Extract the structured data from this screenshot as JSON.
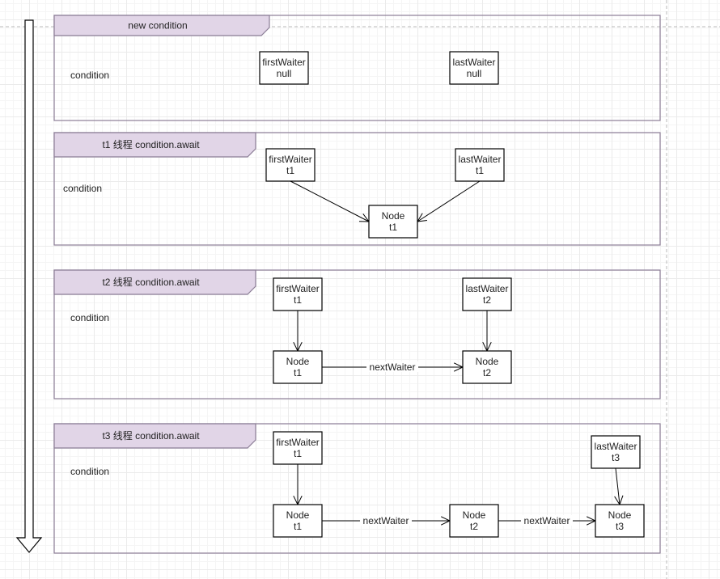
{
  "colors": {
    "frame_border": "#8b7d96",
    "tab_fill": "#e1d5e7",
    "box_border": "#000000"
  },
  "sections": [
    {
      "title": "new condition",
      "side_label": "condition",
      "boxes": [
        {
          "id": "s1-first",
          "line1": "firstWaiter",
          "line2": "null"
        },
        {
          "id": "s1-last",
          "line1": "lastWaiter",
          "line2": "null"
        }
      ],
      "edges": []
    },
    {
      "title": "t1 线程 condition.await",
      "side_label": "condition",
      "boxes": [
        {
          "id": "s2-first",
          "line1": "firstWaiter",
          "line2": "t1"
        },
        {
          "id": "s2-last",
          "line1": "lastWaiter",
          "line2": "t1"
        },
        {
          "id": "s2-node1",
          "line1": "Node",
          "line2": "t1"
        }
      ],
      "edges": [
        {
          "from": "s2-first",
          "to": "s2-node1",
          "label": ""
        },
        {
          "from": "s2-last",
          "to": "s2-node1",
          "label": ""
        }
      ]
    },
    {
      "title": "t2 线程 condition.await",
      "side_label": "condition",
      "boxes": [
        {
          "id": "s3-first",
          "line1": "firstWaiter",
          "line2": "t1"
        },
        {
          "id": "s3-last",
          "line1": "lastWaiter",
          "line2": "t2"
        },
        {
          "id": "s3-node1",
          "line1": "Node",
          "line2": "t1"
        },
        {
          "id": "s3-node2",
          "line1": "Node",
          "line2": "t2"
        }
      ],
      "edges": [
        {
          "from": "s3-first",
          "to": "s3-node1",
          "label": ""
        },
        {
          "from": "s3-last",
          "to": "s3-node2",
          "label": ""
        },
        {
          "from": "s3-node1",
          "to": "s3-node2",
          "label": "nextWaiter"
        }
      ]
    },
    {
      "title": "t3 线程 condition.await",
      "side_label": "condition",
      "boxes": [
        {
          "id": "s4-first",
          "line1": "firstWaiter",
          "line2": "t1"
        },
        {
          "id": "s4-last",
          "line1": "lastWaiter",
          "line2": "t3"
        },
        {
          "id": "s4-node1",
          "line1": "Node",
          "line2": "t1"
        },
        {
          "id": "s4-node2",
          "line1": "Node",
          "line2": "t2"
        },
        {
          "id": "s4-node3",
          "line1": "Node",
          "line2": "t3"
        }
      ],
      "edges": [
        {
          "from": "s4-first",
          "to": "s4-node1",
          "label": ""
        },
        {
          "from": "s4-last",
          "to": "s4-node3",
          "label": ""
        },
        {
          "from": "s4-node1",
          "to": "s4-node2",
          "label": "nextWaiter"
        },
        {
          "from": "s4-node2",
          "to": "s4-node3",
          "label": "nextWaiter"
        }
      ]
    }
  ]
}
